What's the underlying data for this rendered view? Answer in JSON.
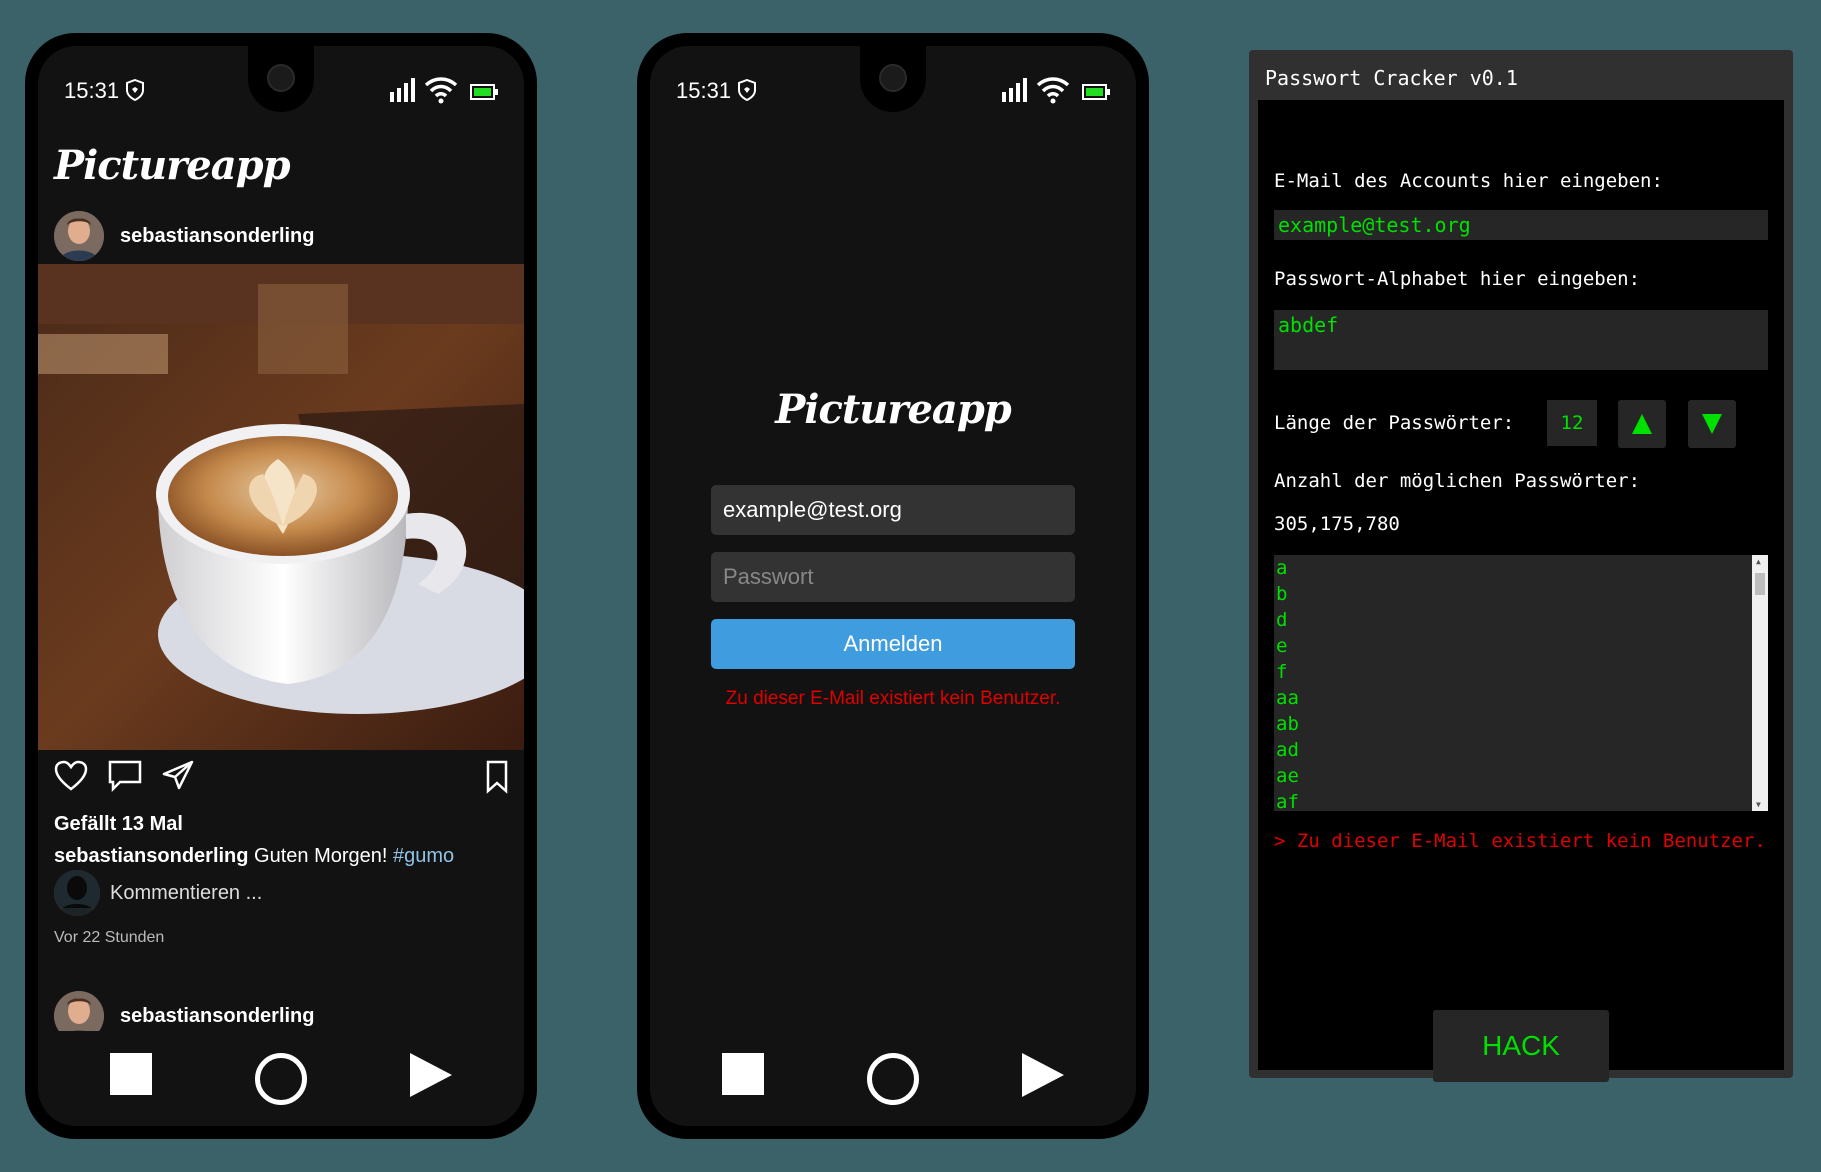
{
  "feed_phone": {
    "status": {
      "time": "15:31"
    },
    "logo": "Pictureapp",
    "post": {
      "username": "sebastiansonderling",
      "likes": "Gefällt 13 Mal",
      "caption_user": "sebastiansonderling",
      "caption_text": " Guten Morgen! ",
      "caption_tag": "#gumo",
      "comment_placeholder": "Kommentieren ...",
      "time_ago": "Vor 22 Stunden"
    },
    "next_post": {
      "username": "sebastiansonderling"
    }
  },
  "login_phone": {
    "status": {
      "time": "15:31"
    },
    "logo": "Pictureapp",
    "email_value": "example@test.org",
    "password_placeholder": "Passwort",
    "submit_label": "Anmelden",
    "error": "Zu dieser E-Mail existiert kein Benutzer."
  },
  "cracker": {
    "title": "Passwort Cracker v0.1",
    "email_label": "E-Mail des Accounts hier eingeben:",
    "email_value": "example@test.org",
    "alphabet_label": "Passwort-Alphabet hier eingeben:",
    "alphabet_value": "abdef",
    "length_label": "Länge der Passwörter:",
    "length_value": "12",
    "count_label": "Anzahl der möglichen Passwörter:",
    "count_value": "305,175,780",
    "output_lines": [
      "a",
      "b",
      "d",
      "e",
      "f",
      "aa",
      "ab",
      "ad",
      "ae",
      "af"
    ],
    "error": "> Zu dieser E-Mail existiert kein Benutzer.",
    "hack_label": "HACK"
  },
  "colors": {
    "accent_green": "#00e000",
    "error_red": "#e00000",
    "button_blue": "#3f9ddf",
    "background": "#3b6268"
  }
}
